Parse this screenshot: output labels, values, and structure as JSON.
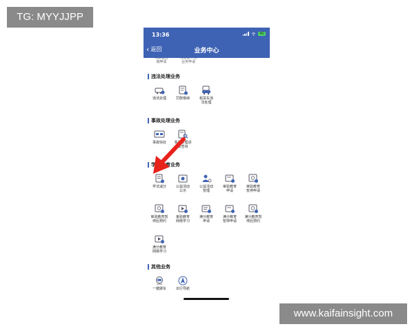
{
  "watermarks": {
    "top_left": "TG: MYYJJPP",
    "bottom_right": "www.kaifainsight.com"
  },
  "status_bar": {
    "time": "13:36",
    "battery": "4G"
  },
  "header": {
    "back_label": "返回",
    "title": "业务中心"
  },
  "partial_items": [
    {
      "label": "驾驶证注\n销申请"
    },
    {
      "label": "驾驶证申领\n业务申请"
    }
  ],
  "sections": [
    {
      "title": "违法处理业务",
      "items": [
        {
          "label": "违法处理",
          "icon": "car-ticket-icon"
        },
        {
          "label": "罚款缴纳",
          "icon": "payment-document-icon"
        },
        {
          "label": "租赁车违\n法处理",
          "icon": "rental-car-icon"
        }
      ]
    },
    {
      "title": "事故处理业务",
      "items": [
        {
          "label": "事故快处",
          "icon": "accident-icon"
        },
        {
          "label": "事故处理进\n度查询",
          "icon": "accident-search-icon"
        }
      ]
    },
    {
      "title": "学习教育业务",
      "items": [
        {
          "label": "学法减分",
          "icon": "study-deduct-icon"
        },
        {
          "label": "公益活动\n公示",
          "icon": "public-welfare-icon"
        },
        {
          "label": "公益活动\n管理",
          "icon": "activity-manage-icon"
        },
        {
          "label": "审验教育\n申请",
          "icon": "review-education-icon"
        },
        {
          "label": "审验教育\n暂停申请",
          "icon": "review-pause-icon"
        },
        {
          "label": "审验教育暂\n停后预约",
          "icon": "review-appointment-icon"
        },
        {
          "label": "审验教育\n网络学习",
          "icon": "review-online-icon"
        },
        {
          "label": "满分教育\n申请",
          "icon": "full-score-apply-icon"
        },
        {
          "label": "满分教育\n暂停申请",
          "icon": "full-score-pause-icon"
        },
        {
          "label": "满分教育暂\n停后预约",
          "icon": "full-score-appointment-icon"
        },
        {
          "label": "满分教育\n网络学习",
          "icon": "full-score-online-icon"
        }
      ]
    },
    {
      "title": "其他业务",
      "items": [
        {
          "label": "一键挪车",
          "icon": "move-car-icon"
        },
        {
          "label": "出行导航",
          "icon": "navigation-icon"
        }
      ]
    }
  ],
  "colors": {
    "header_bg": "#3f63b4",
    "icon_blue": "#3f63b4",
    "arrow_red": "#e8231c"
  }
}
